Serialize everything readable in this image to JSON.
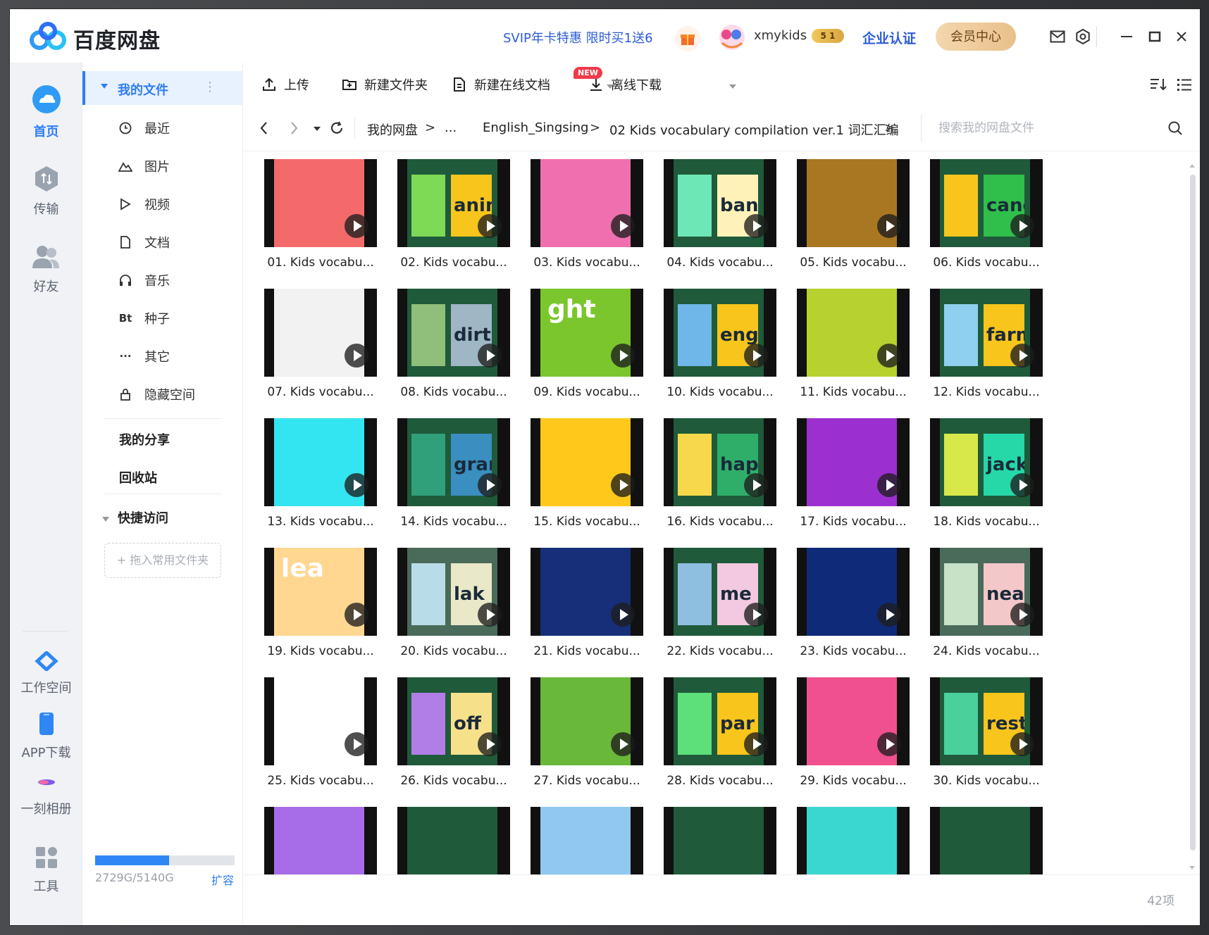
{
  "app": {
    "title": "百度网盘",
    "promo": "SVIP年卡特惠 限时买1送6",
    "username": "xmykids",
    "vip_badge": "5 1",
    "enterprise": "企业认证",
    "member_center": "会员中心"
  },
  "leftnav": [
    {
      "label": "首页",
      "icon": "cloud-icon",
      "active": true
    },
    {
      "label": "传输",
      "icon": "transfer-icon"
    },
    {
      "label": "好友",
      "icon": "friends-icon"
    },
    {
      "label": "工作空间",
      "icon": "workspace-icon"
    },
    {
      "label": "APP下载",
      "icon": "phone-icon"
    },
    {
      "label": "一刻相册",
      "icon": "album-icon"
    },
    {
      "label": "工具",
      "icon": "tools-icon"
    }
  ],
  "sidebar": {
    "my_files": "我的文件",
    "items": [
      {
        "label": "最近",
        "icon": "clock-icon"
      },
      {
        "label": "图片",
        "icon": "image-icon"
      },
      {
        "label": "视频",
        "icon": "video-icon"
      },
      {
        "label": "文档",
        "icon": "document-icon"
      },
      {
        "label": "音乐",
        "icon": "headphones-icon"
      },
      {
        "label": "种子",
        "icon": "bt-icon",
        "glyph": "Bt"
      },
      {
        "label": "其它",
        "icon": "more-icon"
      },
      {
        "label": "隐藏空间",
        "icon": "lock-icon"
      }
    ],
    "my_share": "我的分享",
    "recycle": "回收站",
    "quick_access": "快捷访问",
    "drop_hint": "+ 拖入常用文件夹",
    "storage": "2729G/5140G",
    "storage_used_fraction": 0.531,
    "expand": "扩容"
  },
  "toolbar": {
    "upload": "上传",
    "new_folder": "新建文件夹",
    "new_doc": "新建在线文档",
    "new_badge": "NEW",
    "offline_download": "离线下载"
  },
  "path": {
    "root": "我的网盘",
    "ellipsis": "...",
    "folder1": "English_Singsing",
    "folder2": "02 Kids vocabulary compilation ver.1 词汇汇编",
    "sep": ">",
    "search_placeholder": "搜索我的网盘文件"
  },
  "files": [
    {
      "name": "01. Kids vocabu...",
      "bg": "#f46a6a",
      "word": "",
      "wordbg": ""
    },
    {
      "name": "02. Kids vocabu...",
      "bg": "#1f5a3a",
      "word": "anim",
      "wordbg": "#f7c51c",
      "left": "#7ed957"
    },
    {
      "name": "03. Kids vocabu...",
      "bg": "#f06fae",
      "word": "",
      "wordbg": ""
    },
    {
      "name": "04. Kids vocabu...",
      "bg": "#1f5a3a",
      "word": "bana",
      "wordbg": "#fff2b8",
      "left": "#6ee7b7"
    },
    {
      "name": "05. Kids vocabu...",
      "bg": "#a97722",
      "word": "",
      "wordbg": ""
    },
    {
      "name": "06. Kids vocabu...",
      "bg": "#1f5a3a",
      "word": "canoe",
      "wordbg": "#2fbf4a",
      "left": "#f7c51c"
    },
    {
      "name": "07. Kids vocabu...",
      "bg": "#f2f2f2",
      "word": "",
      "wordbg": ""
    },
    {
      "name": "08. Kids vocabu...",
      "bg": "#1f5a3a",
      "word": "dirt",
      "wordbg": "#9fb6c4",
      "left": "#8fbf7a"
    },
    {
      "name": "09. Kids vocabu...",
      "bg": "#7bc62d",
      "word": "ght",
      "wordbg": "",
      "left": ""
    },
    {
      "name": "10. Kids vocabu...",
      "bg": "#1f5a3a",
      "word": "engin",
      "wordbg": "#f7c51c",
      "left": "#6fb7e8"
    },
    {
      "name": "11. Kids vocabu...",
      "bg": "#b7d12e",
      "word": "",
      "wordbg": ""
    },
    {
      "name": "12. Kids vocabu...",
      "bg": "#1f5a3a",
      "word": "farm",
      "wordbg": "#f7c51c",
      "left": "#8fd0f0"
    },
    {
      "name": "13. Kids vocabu...",
      "bg": "#33e5f0",
      "word": "",
      "wordbg": ""
    },
    {
      "name": "14. Kids vocabu...",
      "bg": "#1f5a3a",
      "word": "grand",
      "wordbg": "#3a8ec0",
      "left": "#2fa07a"
    },
    {
      "name": "15. Kids vocabu...",
      "bg": "#ffc81a",
      "word": "",
      "wordbg": ""
    },
    {
      "name": "16. Kids vocabu...",
      "bg": "#1f5a3a",
      "word": "hap",
      "wordbg": "#2fae6a",
      "left": "#f7d84a"
    },
    {
      "name": "17. Kids vocabu...",
      "bg": "#9c2fd0",
      "word": "",
      "wordbg": ""
    },
    {
      "name": "18. Kids vocabu...",
      "bg": "#1f5a3a",
      "word": "jack",
      "wordbg": "#26d7a8",
      "left": "#d8e84a"
    },
    {
      "name": "19. Kids vocabu...",
      "bg": "#ffd790",
      "word": "lea",
      "wordbg": "",
      "left": ""
    },
    {
      "name": "20. Kids vocabu...",
      "bg": "#4a6a5a",
      "word": "lak",
      "wordbg": "#e9e8c8",
      "left": "#b8dde8"
    },
    {
      "name": "21. Kids vocabu...",
      "bg": "#172f78",
      "word": "",
      "wordbg": ""
    },
    {
      "name": "22. Kids vocabu...",
      "bg": "#1f5a3a",
      "word": "me",
      "wordbg": "#f2c9e0",
      "left": "#8fbfe0"
    },
    {
      "name": "23. Kids vocabu...",
      "bg": "#0f2a78",
      "word": "",
      "wordbg": ""
    },
    {
      "name": "24. Kids vocabu...",
      "bg": "#4a6a5a",
      "word": "nea",
      "wordbg": "#f4c8c8",
      "left": "#c8e2c8"
    },
    {
      "name": "25. Kids vocabu...",
      "bg": "#ffffff",
      "word": "",
      "wordbg": ""
    },
    {
      "name": "26. Kids vocabu...",
      "bg": "#1f5a3a",
      "word": "off",
      "wordbg": "#f7e08a",
      "left": "#b17ee8"
    },
    {
      "name": "27. Kids vocabu...",
      "bg": "#6ab83a",
      "word": "",
      "wordbg": ""
    },
    {
      "name": "28. Kids vocabu...",
      "bg": "#1f5a3a",
      "word": "par",
      "wordbg": "#f7c51c",
      "left": "#5de07a"
    },
    {
      "name": "29. Kids vocabu...",
      "bg": "#f0508e",
      "word": "",
      "wordbg": ""
    },
    {
      "name": "30. Kids vocabu...",
      "bg": "#1f5a3a",
      "word": "restau",
      "wordbg": "#f7c51c",
      "left": "#4ad09a"
    },
    {
      "name": "",
      "bg": "#a76de8",
      "word": "",
      "wordbg": ""
    },
    {
      "name": "",
      "bg": "#1f5a3a",
      "word": "",
      "wordbg": ""
    },
    {
      "name": "",
      "bg": "#8fc8f0",
      "word": "",
      "wordbg": ""
    },
    {
      "name": "",
      "bg": "#1f5a3a",
      "word": "",
      "wordbg": ""
    },
    {
      "name": "",
      "bg": "#3ad7d0",
      "word": "",
      "wordbg": ""
    },
    {
      "name": "",
      "bg": "#1f5a3a",
      "word": "",
      "wordbg": ""
    }
  ],
  "footer": {
    "count": "42项"
  },
  "colors": {
    "accent": "#2f7df6",
    "promo": "#2b5bd7"
  }
}
